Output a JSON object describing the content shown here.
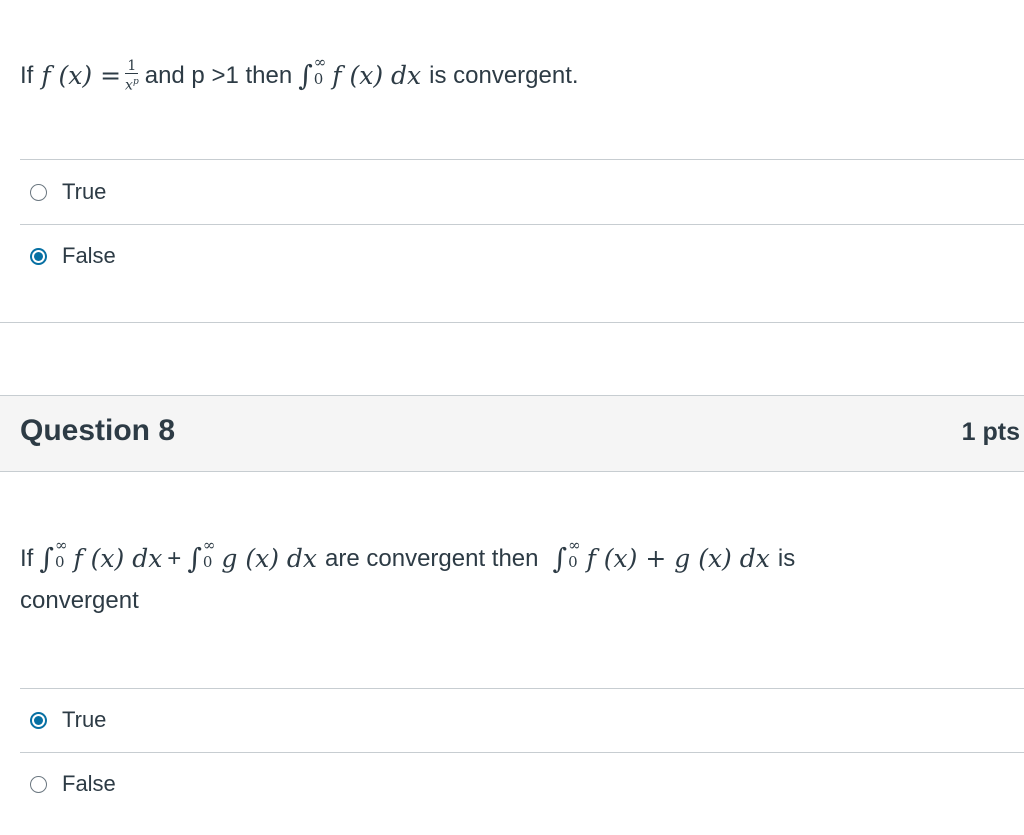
{
  "question_7": {
    "prefix": "If",
    "function_lhs": "f (x) =",
    "fraction_numerator": "1",
    "fraction_denominator": "x",
    "fraction_exponent": "p",
    "condition": "and p >1 then",
    "integral_upper": "∞",
    "integral_lower": "0",
    "integrand": "f (x) dx",
    "suffix": "is convergent.",
    "answers": [
      {
        "label": "True",
        "selected": false
      },
      {
        "label": "False",
        "selected": true
      }
    ]
  },
  "question_8": {
    "title": "Question 8",
    "points": "1 pts",
    "prefix": "If",
    "integral_upper": "∞",
    "integral_lower": "0",
    "integrand_f": "f (x) dx",
    "plus": "+",
    "integrand_g": "g (x) dx",
    "middle": "are convergent then",
    "integrand_sum": "f (x) + g (x) dx",
    "suffix": "is",
    "suffix_line2": "convergent",
    "answers": [
      {
        "label": "True",
        "selected": true
      },
      {
        "label": "False",
        "selected": false
      }
    ]
  },
  "colors": {
    "text": "#2d3b45",
    "selected_radio": "#0770a3",
    "divider": "#c7cdd1",
    "header_bg": "#f5f5f5"
  }
}
